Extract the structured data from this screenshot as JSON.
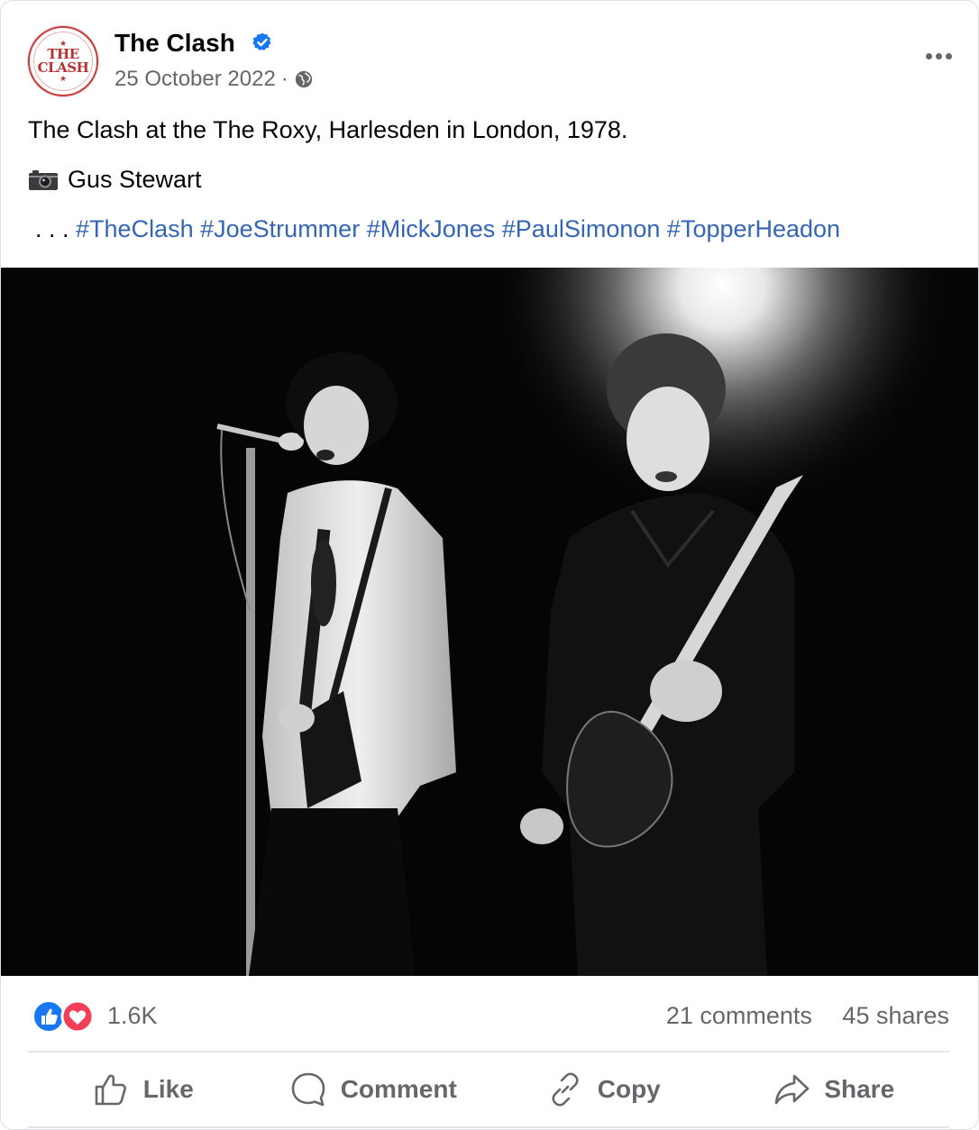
{
  "post": {
    "page_name": "The Clash",
    "avatar_text_top": "THE",
    "avatar_text_bottom": "CLASH",
    "date": "25 October 2022",
    "separator": "·",
    "privacy_icon": "globe-icon",
    "verified_icon": "verified-badge-icon",
    "more_icon": "more-options-icon",
    "caption": "The Clash at the The Roxy, Harlesden in London, 1978.",
    "credit_icon": "camera-icon",
    "credit": "Gus Stewart",
    "ellipsis": ". . .",
    "hashtags": [
      "#TheClash",
      "#JoeStrummer",
      "#MickJones",
      "#PaulSimonon",
      "#TopperHeadon"
    ],
    "photo_description_icon": "concert-photo"
  },
  "stats": {
    "reactions_count": "1.6K",
    "reaction_icons": [
      "like-reaction-icon",
      "love-reaction-icon"
    ],
    "comments": "21 comments",
    "shares": "45 shares"
  },
  "actions": {
    "like_label": "Like",
    "comment_label": "Comment",
    "copy_label": "Copy",
    "share_label": "Share"
  },
  "colors": {
    "hashtag": "#3565b5",
    "like_blue": "#1877f2",
    "love_red": "#f33e58",
    "secondary_text": "#65676b",
    "logo_red": "#b83232"
  }
}
